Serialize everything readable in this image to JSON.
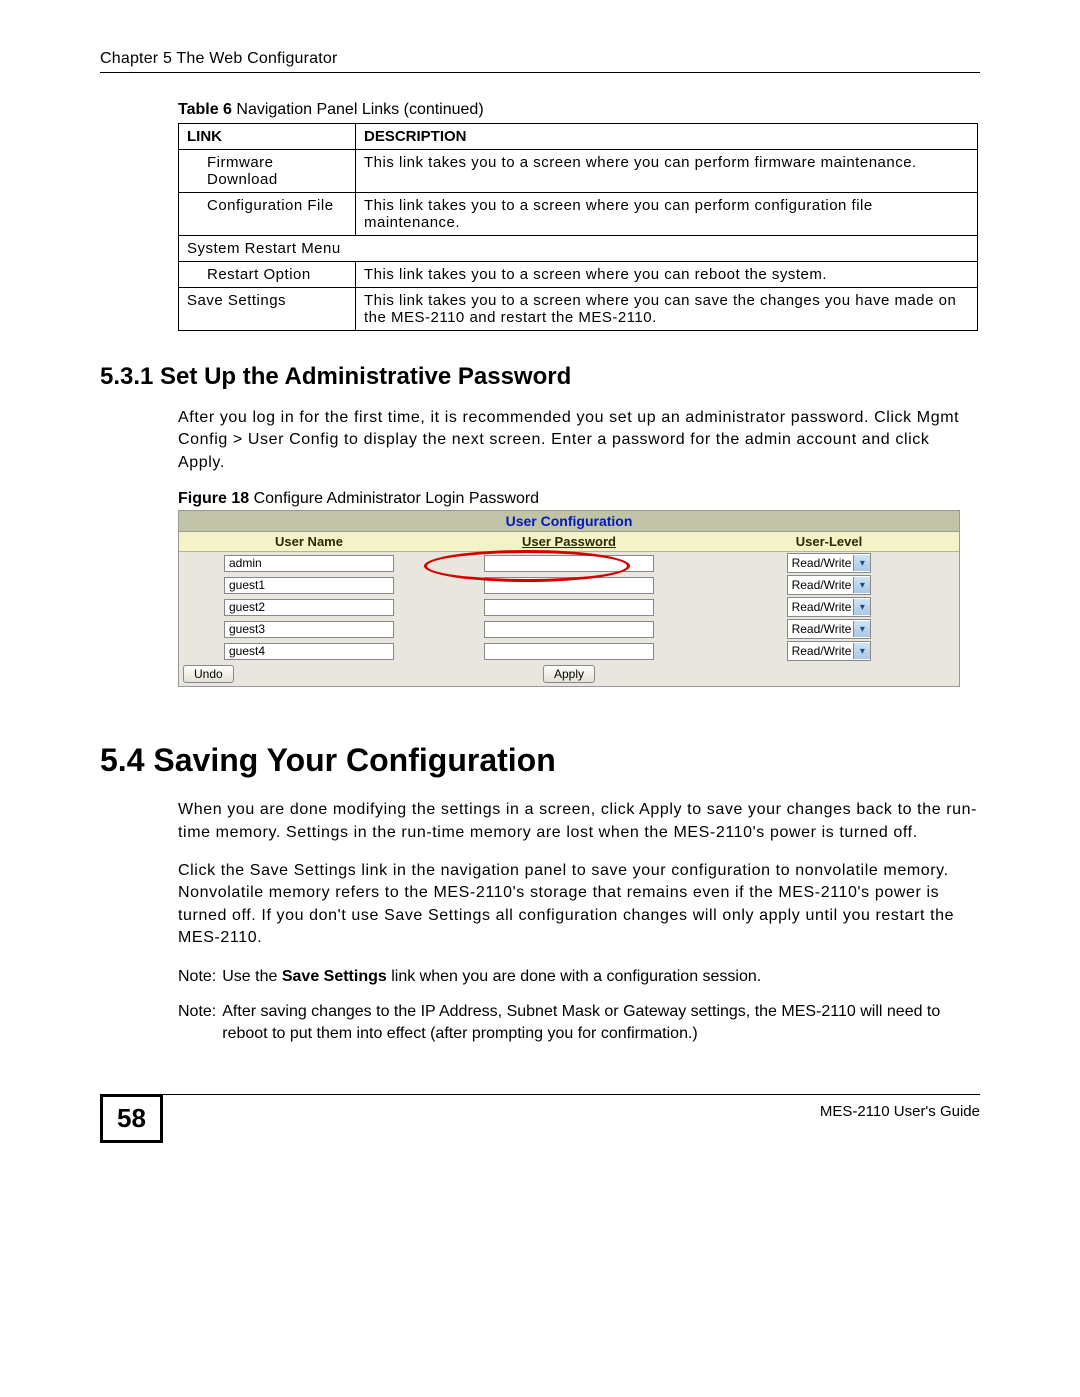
{
  "header": "Chapter 5 The Web Configurator",
  "table6": {
    "caption_bold": "Table 6",
    "caption_rest": "   Navigation Panel Links  (continued)",
    "col_link": "LINK",
    "col_desc": "DESCRIPTION",
    "rows": [
      {
        "link": "Firmware Download",
        "desc": "This link takes you to a screen where you can perform firmware maintenance."
      },
      {
        "link": "Configuration File",
        "desc": "This link takes you to a screen where you can perform configuration file maintenance."
      }
    ],
    "section_row": "System Restart Menu",
    "rows2": [
      {
        "link": "Restart Option",
        "desc": "This link takes you to a screen where you can reboot the system."
      },
      {
        "link": "Save Settings",
        "desc": "This link takes you to a screen where you can save the changes you have made on the MES-2110 and restart the MES-2110."
      }
    ]
  },
  "sec531": {
    "title": "5.3.1  Set Up the Administrative Password",
    "para": "After you log in for the first time, it is recommended you set up an administrator password. Click Mgmt Config > User Config to display the next screen. Enter a password for the admin account and click Apply."
  },
  "fig18": {
    "caption_bold": "Figure 18",
    "caption_rest": "   Configure Administrator Login Password",
    "title": "User Configuration",
    "col_user": "User Name",
    "col_pass": "User Password",
    "col_level": "User-Level",
    "users": [
      "admin",
      "guest1",
      "guest2",
      "guest3",
      "guest4"
    ],
    "level_value": "Read/Write",
    "btn_undo": "Undo",
    "btn_apply": "Apply"
  },
  "sec54": {
    "title": "5.4  Saving Your Configuration",
    "p1": "When you are done modifying the settings in a screen, click Apply to save your changes back to the run-time memory. Settings in the run-time memory are lost when the MES-2110's power is turned off.",
    "p2": "Click the Save Settings link in the navigation panel to save your configuration to nonvolatile memory. Nonvolatile memory refers to the MES-2110's storage that remains even if the MES-2110's power is turned off. If you don't use Save Settings all configuration changes will only apply until you restart the MES-2110.",
    "note1_label": "Note:",
    "note1_a": "Use the ",
    "note1_bold": "Save Settings",
    "note1_b": " link when you are done with a configuration session.",
    "note2_label": "Note:",
    "note2": "After saving changes to the IP Address, Subnet Mask or Gateway settings, the MES-2110 will need to reboot to put them into effect (after prompting you for confirmation.)"
  },
  "footer": {
    "page": "58",
    "guide": "MES-2110 User's Guide"
  }
}
